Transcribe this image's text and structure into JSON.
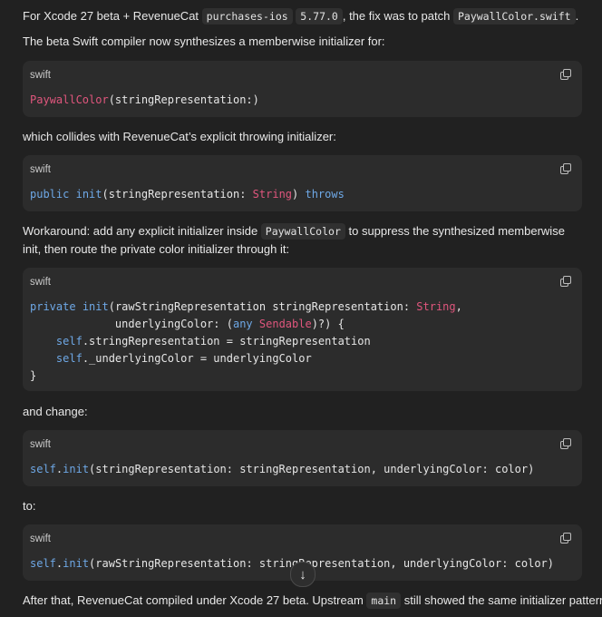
{
  "p1": {
    "pre": "For Xcode 27 beta + RevenueCat ",
    "code1": "purchases-ios",
    "code2": "5.77.0",
    "mid": ", the fix was to patch ",
    "code3": "PaywallColor.swift",
    "post": "."
  },
  "p2": "The beta Swift compiler now synthesizes a memberwise initializer for:",
  "block1": {
    "lang": "swift",
    "t1": "PaywallColor",
    "t2": "(stringRepresentation:)"
  },
  "p3": "which collides with RevenueCat’s explicit throwing initializer:",
  "block2": {
    "lang": "swift",
    "kw1": "public",
    "sp1": " ",
    "kw2": "init",
    "t1": "(stringRepresentation: ",
    "ty1": "String",
    "t2": ") ",
    "kw3": "throws"
  },
  "p4": {
    "pre": "Workaround: add any explicit initializer inside ",
    "code": "PaywallColor",
    "post": " to suppress the synthesized memberwise init, then route the private color initializer through it:"
  },
  "block3": {
    "lang": "swift",
    "l1_kw1": "private",
    "l1_sp": " ",
    "l1_kw2": "init",
    "l1_t1": "(rawStringRepresentation stringRepresentation: ",
    "l1_ty": "String",
    "l1_t2": ",",
    "l2_t1": "             underlyingColor: (",
    "l2_kw": "any",
    "l2_sp": " ",
    "l2_ty": "Sendable",
    "l2_t2": ")?) {",
    "l3_ind": "    ",
    "l3_kw": "self",
    "l3_t": ".stringRepresentation = stringRepresentation",
    "l4_ind": "    ",
    "l4_kw": "self",
    "l4_t": "._underlyingColor = underlyingColor",
    "l5": "}"
  },
  "p5": "and change:",
  "block4": {
    "lang": "swift",
    "kw1": "self",
    "dot": ".",
    "kw2": "init",
    "t": "(stringRepresentation: stringRepresentation, underlyingColor: color)"
  },
  "p6": "to:",
  "block5": {
    "lang": "swift",
    "kw1": "self",
    "dot": ".",
    "kw2": "init",
    "t": "(rawStringRepresentation: stringRepresentation, underlyingColor: color)"
  },
  "p7": {
    "pre": "After that, RevenueCat compiled under Xcode 27 beta. Upstream ",
    "code": "main",
    "post": " still showed the same initializer pattern"
  },
  "scroll_button": {
    "glyph": "↓",
    "icon": "arrow-down-icon"
  },
  "copy_icon": "copy-icon"
}
